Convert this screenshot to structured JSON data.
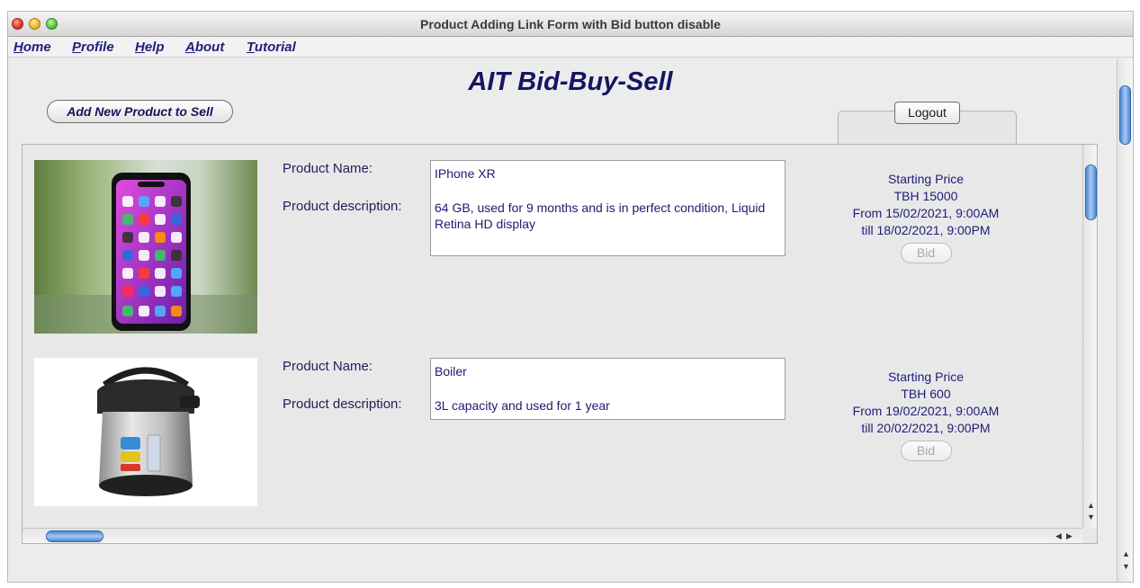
{
  "window": {
    "title": "Product Adding Link Form with Bid button disable"
  },
  "menu": {
    "items": [
      {
        "first": "H",
        "rest": "ome"
      },
      {
        "first": "P",
        "rest": "rofile"
      },
      {
        "first": "H",
        "rest": "elp"
      },
      {
        "first": "A",
        "rest": "bout"
      },
      {
        "first": "T",
        "rest": "utorial"
      }
    ]
  },
  "header": {
    "app_title": "AIT Bid-Buy-Sell",
    "add_button": "Add New Product to Sell",
    "logout_button": "Logout"
  },
  "labels": {
    "product_name": "Product Name:",
    "product_description": "Product description:"
  },
  "products": [
    {
      "image_icon": "smartphone-photo",
      "name": "IPhone XR",
      "description": "64 GB, used for 9 months and is in perfect condition, Liquid Retina HD display",
      "price_label": "Starting Price",
      "price": "TBH 15000",
      "from": "From 15/02/2021, 9:00AM",
      "till": "till  18/02/2021, 9:00PM",
      "bid_label": "Bid"
    },
    {
      "image_icon": "electric-boiler-photo",
      "name": "Boiler",
      "description": "3L capacity and used for 1 year",
      "price_label": "Starting Price",
      "price": "TBH 600",
      "from": "From 19/02/2021, 9:00AM",
      "till": "till  20/02/2021, 9:00PM",
      "bid_label": "Bid"
    }
  ],
  "scroll": {
    "left_arrow": "◀",
    "right_arrow": "▶",
    "up_arrow": "▲",
    "down_arrow": "▼"
  },
  "colors": {
    "accent": "#1e1e7a",
    "title": "#151563",
    "scroll_thumb": "#4b88d4"
  }
}
